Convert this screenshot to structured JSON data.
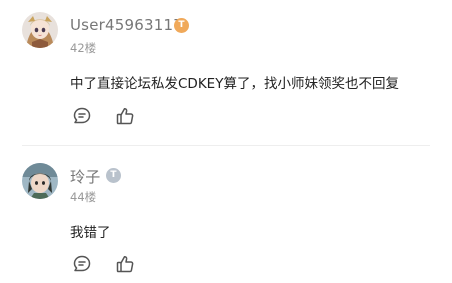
{
  "comments": [
    {
      "username": "User45963117",
      "badge": {
        "letter": "T",
        "color": "#f0a95a"
      },
      "floor": "42楼",
      "content": "中了直接论坛私发CDKEY算了，找小师妹领奖也不回复",
      "actions": {
        "reply_icon": "comment-bubble-icon",
        "like_icon": "thumbs-up-icon"
      }
    },
    {
      "username": "玲子",
      "badge": {
        "letter": "T",
        "color": "#b9c2cc"
      },
      "floor": "44楼",
      "content": "我错了",
      "actions": {
        "reply_icon": "comment-bubble-icon",
        "like_icon": "thumbs-up-icon"
      }
    }
  ],
  "colors": {
    "username": "#777777",
    "floor": "#999999",
    "content": "#222222",
    "icon": "#555555"
  }
}
